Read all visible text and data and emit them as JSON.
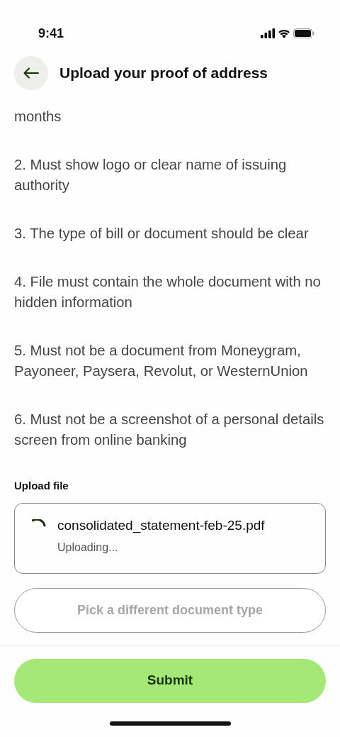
{
  "status_bar": {
    "time": "9:41"
  },
  "header": {
    "title": "Upload your proof of address"
  },
  "requirements": [
    "months",
    "2. Must show logo or clear name of issuing authority",
    "3. The type of bill or document should be clear",
    "4. File must contain the whole document with no hidden information",
    "5. Must not be a document from Moneygram, Payoneer, Paysera, Revolut, or WesternUnion",
    "6. Must not be a screenshot of a personal details screen from online banking"
  ],
  "upload": {
    "label": "Upload file",
    "file_name": "consolidated_statement-feb-25.pdf",
    "status": "Uploading..."
  },
  "secondary_button": {
    "label": "Pick a different document type",
    "disabled": true
  },
  "primary_button": {
    "label": "Submit"
  }
}
